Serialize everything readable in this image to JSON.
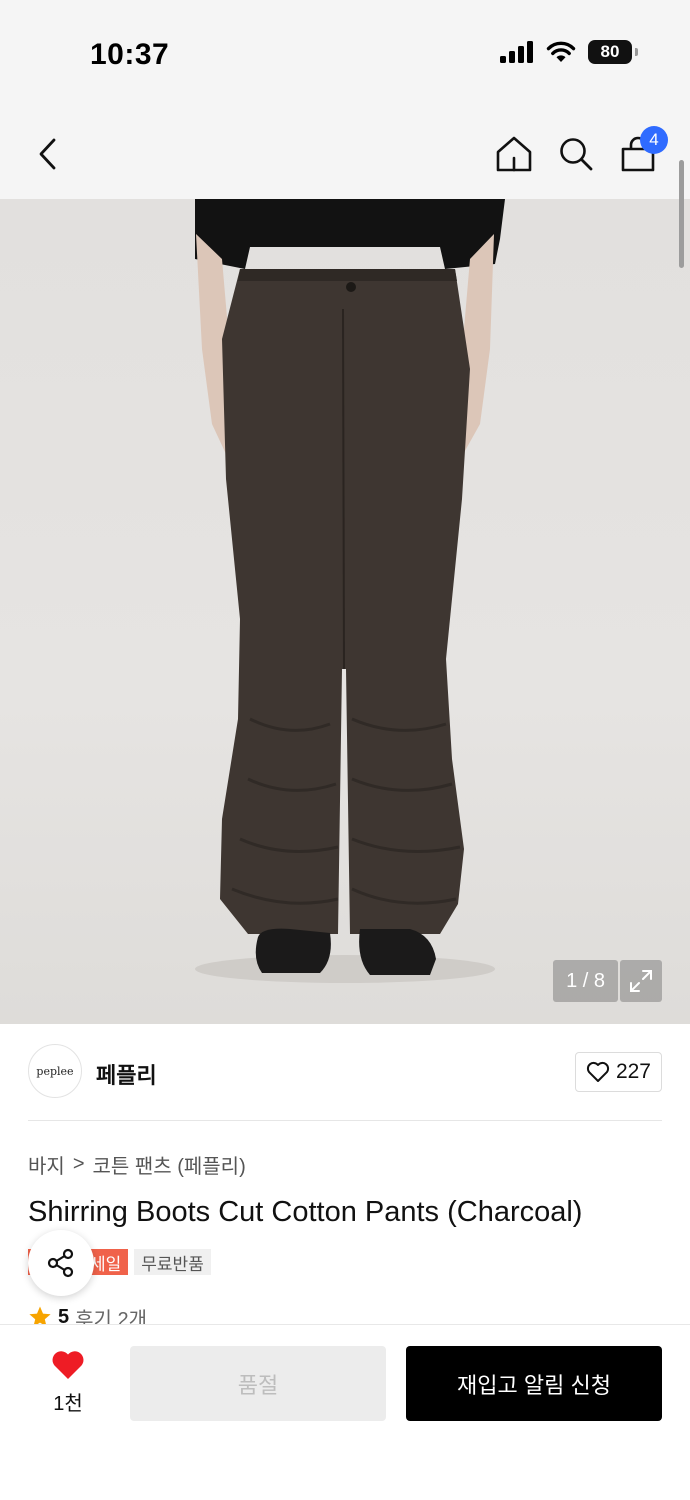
{
  "status_bar": {
    "time": "10:37",
    "battery": "80"
  },
  "nav": {
    "cart_count": "4"
  },
  "gallery": {
    "counter": "1 / 8"
  },
  "brand": {
    "logo_text": "peplee",
    "name": "페플리",
    "likes": "227"
  },
  "breadcrumb": {
    "category": "바지",
    "separator": ">",
    "subcategory": "코튼 팬츠 (페플리)"
  },
  "product": {
    "title": "Shirring Boots Cut Cotton Pants (Charcoal)"
  },
  "tags": {
    "sale": "세일",
    "free_return": "무료반품"
  },
  "rating": {
    "score": "5",
    "reviews": "후기 2개"
  },
  "bottom": {
    "wish_count": "1천",
    "soldout_label": "품절",
    "restock_label": "재입고 알림 신청"
  },
  "colors": {
    "sale_tag": "#f0624a",
    "badge": "#2f6bff",
    "heart": "#ee1c25",
    "star": "#f7a400"
  }
}
